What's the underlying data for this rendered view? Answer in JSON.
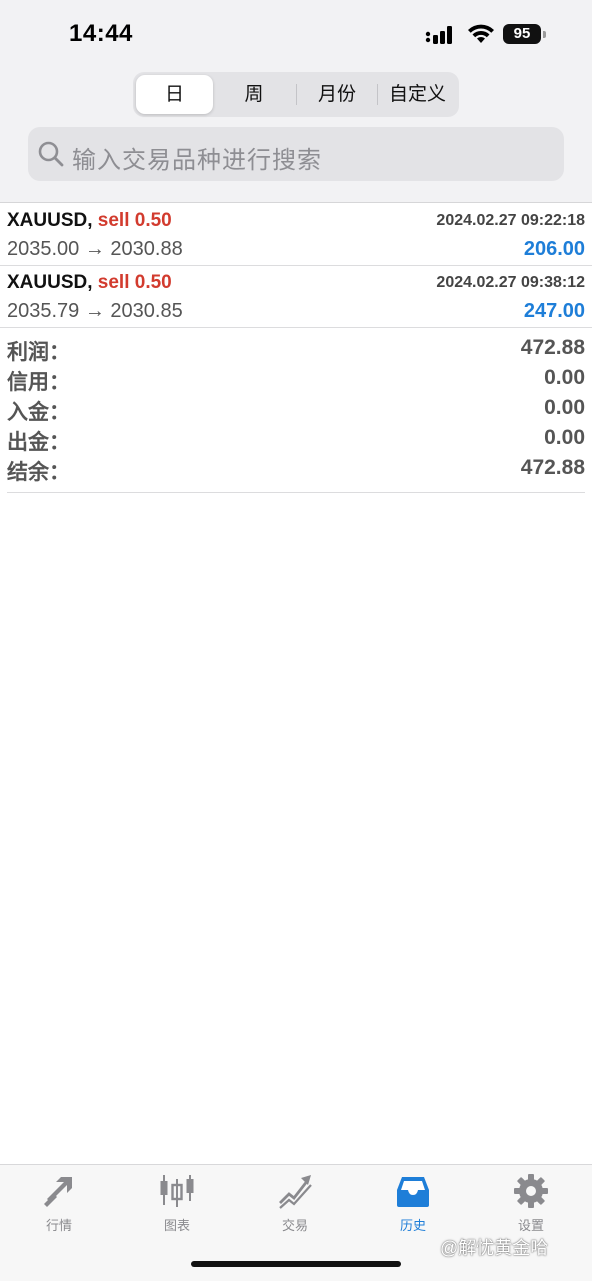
{
  "status_bar": {
    "time": "14:44",
    "battery": "95"
  },
  "period_tabs": [
    {
      "label": "日",
      "active": true
    },
    {
      "label": "周",
      "active": false
    },
    {
      "label": "月份",
      "active": false
    },
    {
      "label": "自定义",
      "active": false
    }
  ],
  "search": {
    "placeholder": "输入交易品种进行搜索"
  },
  "trades": [
    {
      "symbol": "XAUUSD,",
      "side": "sell 0.50",
      "datetime": "2024.02.27 09:22:18",
      "prices": "2035.00 → 2030.88",
      "profit": "206.00"
    },
    {
      "symbol": "XAUUSD,",
      "side": "sell 0.50",
      "datetime": "2024.02.27 09:38:12",
      "prices": "2035.79 → 2030.85",
      "profit": "247.00"
    }
  ],
  "summary": [
    {
      "label": "利润：",
      "value": "472.88"
    },
    {
      "label": "信用：",
      "value": "0.00"
    },
    {
      "label": "入金：",
      "value": "0.00"
    },
    {
      "label": "出金：",
      "value": "0.00"
    },
    {
      "label": "结余：",
      "value": "472.88"
    }
  ],
  "tabbar": [
    {
      "label": "行情",
      "icon": "quotes-arrows-icon",
      "active": false
    },
    {
      "label": "图表",
      "icon": "candlestick-chart-icon",
      "active": false
    },
    {
      "label": "交易",
      "icon": "trade-trend-icon",
      "active": false
    },
    {
      "label": "历史",
      "icon": "history-inbox-icon",
      "active": true
    },
    {
      "label": "设置",
      "icon": "gear-icon",
      "active": false
    }
  ],
  "watermark": "@解忧黄金哈",
  "colors": {
    "sell": "#d23b2e",
    "profit": "#1e7ed8",
    "active_tab": "#1e7ed8",
    "inactive_tab": "#8a8a8e"
  }
}
